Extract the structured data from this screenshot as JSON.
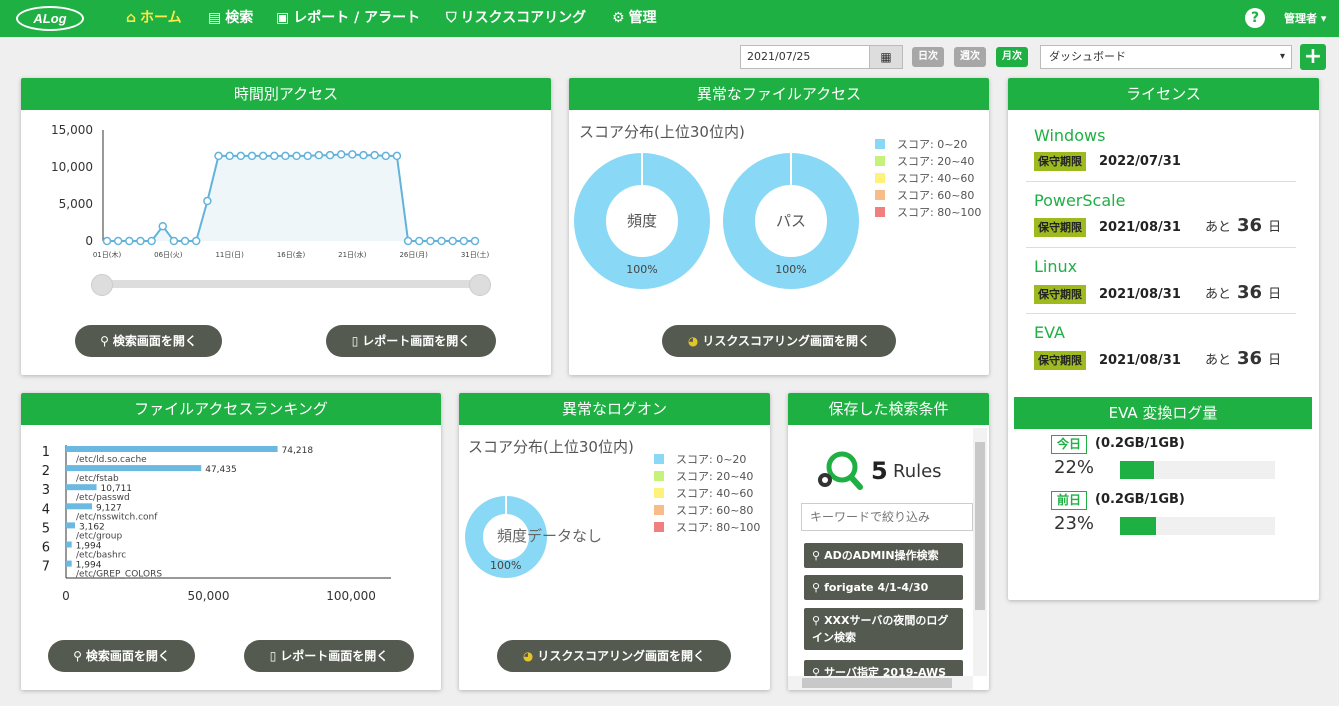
{
  "app": {
    "logo": "ALog"
  },
  "nav": [
    {
      "label": "ホーム",
      "icon": "home-icon",
      "active": true
    },
    {
      "label": "検索",
      "icon": "search-doc-icon"
    },
    {
      "label": "レポート / アラート",
      "icon": "report-icon"
    },
    {
      "label": "リスクスコアリング",
      "icon": "shield-icon"
    },
    {
      "label": "管理",
      "icon": "gear-icon"
    }
  ],
  "header": {
    "help": "?",
    "admin": "管理者"
  },
  "toolbar": {
    "date": "2021/07/25",
    "day": "日次",
    "week": "週次",
    "month": "月次",
    "dashboard": "ダッシュボード",
    "add": "+"
  },
  "hourly": {
    "title": "時間別アクセス",
    "search_btn": "検索画面を開く",
    "report_btn": "レポート画面を開く"
  },
  "abnormal_file": {
    "title": "異常なファイルアクセス",
    "subtitle": "スコア分布(上位30位内)",
    "donut1_label": "頻度",
    "donut1_pct": "100%",
    "donut2_label": "パス",
    "donut2_pct": "100%",
    "btn": "リスクスコアリング画面を開く"
  },
  "legend": [
    {
      "label": "スコア: 0~20",
      "color": "#89d8f5"
    },
    {
      "label": "スコア: 20~40",
      "color": "#c6f27c"
    },
    {
      "label": "スコア: 40~60",
      "color": "#fff27a"
    },
    {
      "label": "スコア: 60~80",
      "color": "#f8bb8a"
    },
    {
      "label": "スコア: 80~100",
      "color": "#f08080"
    }
  ],
  "license": {
    "title": "ライセンス",
    "badge": "保守期限",
    "remain_prefix": "あと",
    "remain_suffix": "日",
    "items": [
      {
        "name": "Windows",
        "date": "2022/07/31",
        "days": ""
      },
      {
        "name": "PowerScale",
        "date": "2021/08/31",
        "days": "36"
      },
      {
        "name": "Linux",
        "date": "2021/08/31",
        "days": "36"
      },
      {
        "name": "EVA",
        "date": "2021/08/31",
        "days": "36"
      }
    ]
  },
  "eva": {
    "title": "EVA 変換ログ量",
    "today_label": "今日",
    "today_amount": "(0.2GB/1GB)",
    "today_pct": "22%",
    "today_value": 22,
    "yesterday_label": "前日",
    "yesterday_amount": "(0.2GB/1GB)",
    "yesterday_pct": "23%",
    "yesterday_value": 23
  },
  "ranking": {
    "title": "ファイルアクセスランキング",
    "search_btn": "検索画面を開く",
    "report_btn": "レポート画面を開く"
  },
  "abnormal_logon": {
    "title": "異常なログオン",
    "subtitle": "スコア分布(上位30位内)",
    "donut_label": "頻度データなし",
    "donut_pct": "100%",
    "btn": "リスクスコアリング画面を開く"
  },
  "saved": {
    "title": "保存した検索条件",
    "count": "5",
    "count_unit": "Rules",
    "placeholder": "キーワードで絞り込み",
    "rules": [
      "ADのADMIN操作検索",
      "forigate 4/1-4/30",
      "XXXサーバの夜間のログイン検索",
      "サーバ指定 2019-AWS"
    ]
  },
  "chart_data": [
    {
      "type": "line",
      "title": "時間別アクセス",
      "x_ticks": [
        "01日(木)",
        "06日(火)",
        "11日(日)",
        "16日(金)",
        "21日(水)",
        "26日(月)",
        "31日(土)"
      ],
      "y_ticks": [
        "0",
        "5,000",
        "10,000",
        "15,000"
      ],
      "ylim": [
        0,
        15000
      ],
      "values": [
        0,
        0,
        0,
        0,
        0,
        2000,
        0,
        0,
        0,
        5400,
        11500,
        11500,
        11500,
        11500,
        11500,
        11500,
        11500,
        11500,
        11500,
        11600,
        11600,
        11700,
        11700,
        11600,
        11600,
        11500,
        11500,
        0,
        0,
        0,
        0,
        0,
        0,
        0
      ]
    },
    {
      "type": "bar",
      "orientation": "horizontal",
      "title": "ファイルアクセスランキング",
      "ranks": [
        "1",
        "2",
        "3",
        "4",
        "5",
        "6",
        "7"
      ],
      "categories": [
        "/etc/ld.so.cache",
        "/etc/fstab",
        "/etc/passwd",
        "/etc/nsswitch.conf",
        "/etc/group",
        "/etc/bashrc",
        "/etc/GREP_COLORS"
      ],
      "values": [
        74218,
        47435,
        10711,
        9127,
        3162,
        1994,
        1994
      ],
      "value_labels": [
        "74,218",
        "47,435",
        "10,711",
        "9,127",
        "3,162",
        "1,994",
        "1,994"
      ],
      "x_ticks": [
        "0",
        "50,000",
        "100,000"
      ],
      "xlim": [
        0,
        114000
      ]
    }
  ]
}
